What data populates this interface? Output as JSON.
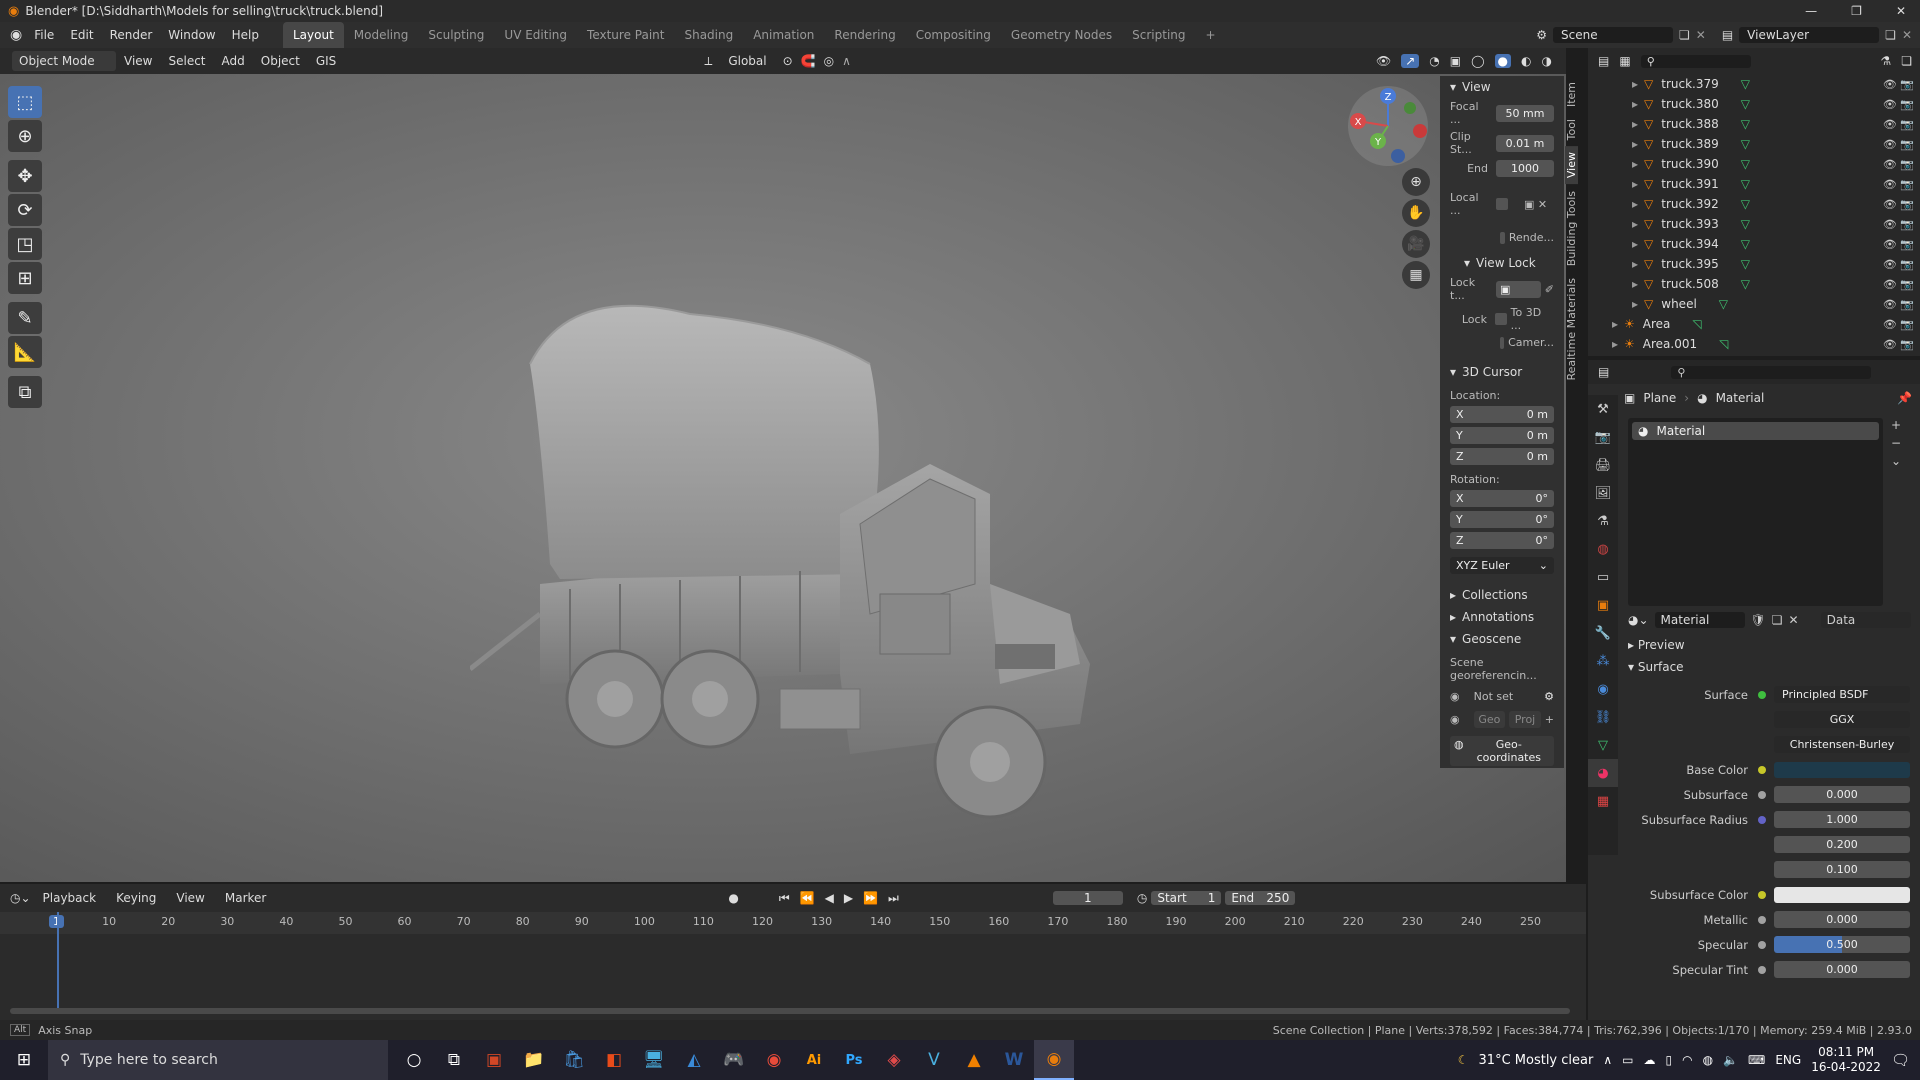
{
  "window": {
    "title": "Blender* [D:\\Siddharth\\Models for selling\\truck\\truck.blend]"
  },
  "menu": [
    "File",
    "Edit",
    "Render",
    "Window",
    "Help"
  ],
  "workspaces": [
    "Layout",
    "Modeling",
    "Sculpting",
    "UV Editing",
    "Texture Paint",
    "Shading",
    "Animation",
    "Rendering",
    "Compositing",
    "Geometry Nodes",
    "Scripting"
  ],
  "active_workspace": "Layout",
  "scene": {
    "label": "Scene",
    "view_layer": "ViewLayer"
  },
  "viewport_header": {
    "mode": "Object Mode",
    "menus": [
      "View",
      "Select",
      "Add",
      "Object",
      "GIS"
    ],
    "transform": "Global"
  },
  "npanel": {
    "view": {
      "title": "View",
      "focal_label": "Focal ...",
      "focal": "50 mm",
      "clip_start_label": "Clip St...",
      "clip_start": "0.01 m",
      "end_label": "End",
      "end": "1000",
      "local_label": "Local ...",
      "render_label": "Rende..."
    },
    "view_lock": {
      "title": "View Lock",
      "lock_to_label": "Lock t...",
      "lock_label": "Lock",
      "to3d_label": "To 3D ...",
      "camera_label": "Camer..."
    },
    "cursor": {
      "title": "3D Cursor",
      "location_label": "Location:",
      "x": "0 m",
      "y": "0 m",
      "z": "0 m",
      "rotation_label": "Rotation:",
      "rx": "0°",
      "ry": "0°",
      "rz": "0°",
      "mode": "XYZ Euler"
    },
    "collections": "Collections",
    "annotations": "Annotations",
    "geoscene": {
      "title": "Geoscene",
      "label": "Scene georeferencin...",
      "not_set": "Not set",
      "geo": "Geo",
      "proj": "Proj",
      "coords": "Geo-coordinates"
    }
  },
  "sidetabs": [
    "Item",
    "Tool",
    "View",
    "Building Tools",
    "Realtime Materials"
  ],
  "outliner": {
    "rows": [
      "truck.379",
      "truck.380",
      "truck.388",
      "truck.389",
      "truck.390",
      "truck.391",
      "truck.392",
      "truck.393",
      "truck.394",
      "truck.395",
      "truck.508",
      "wheel",
      "Area",
      "Area.001"
    ]
  },
  "properties": {
    "object": "Plane",
    "material_tab": "Material",
    "slot": "Material",
    "material_name": "Material",
    "data_label": "Data",
    "preview": "Preview",
    "surface_section": "Surface",
    "rows": [
      {
        "label": "Surface",
        "value": "Principled BSDF",
        "color": "#3fbf3f"
      },
      {
        "label": "",
        "value": "GGX",
        "color": ""
      },
      {
        "label": "",
        "value": "Christensen-Burley",
        "color": ""
      },
      {
        "label": "Base Color",
        "value": "",
        "color": "#c7c729",
        "swatch": "#1e3a4a"
      },
      {
        "label": "Subsurface",
        "value": "0.000",
        "color": "#a1a1a1"
      },
      {
        "label": "Subsurface Radius",
        "value": "1.000",
        "color": "#6363c7"
      },
      {
        "label": "",
        "value": "0.200",
        "color": ""
      },
      {
        "label": "",
        "value": "0.100",
        "color": ""
      },
      {
        "label": "Subsurface Color",
        "value": "",
        "color": "#c7c729",
        "swatch": "#e6e6e6"
      },
      {
        "label": "Metallic",
        "value": "0.000",
        "color": "#a1a1a1"
      },
      {
        "label": "Specular",
        "value": "0.500",
        "color": "#a1a1a1",
        "highlight": 0.5
      },
      {
        "label": "Specular Tint",
        "value": "0.000",
        "color": "#a1a1a1"
      }
    ]
  },
  "timeline": {
    "menus": [
      "Playback",
      "Keying",
      "View",
      "Marker"
    ],
    "current": "1",
    "start_label": "Start",
    "start": "1",
    "end_label": "End",
    "end": "250",
    "ticks": [
      "1",
      "10",
      "20",
      "30",
      "40",
      "50",
      "60",
      "70",
      "80",
      "90",
      "100",
      "110",
      "120",
      "130",
      "140",
      "150",
      "160",
      "170",
      "180",
      "190",
      "200",
      "210",
      "220",
      "230",
      "240",
      "250"
    ]
  },
  "status": {
    "left": "Axis Snap",
    "right": "Scene Collection | Plane | Verts:378,592 | Faces:384,774 | Tris:762,396 | Objects:1/170 | Memory: 259.4 MiB | 2.93.0"
  },
  "taskbar": {
    "search": "Type here to search",
    "weather": "31°C  Mostly clear",
    "lang": "ENG",
    "time": "08:11 PM",
    "date": "16-04-2022"
  },
  "colors": {
    "accent": "#4772b3",
    "orange": "#e87d0d"
  }
}
